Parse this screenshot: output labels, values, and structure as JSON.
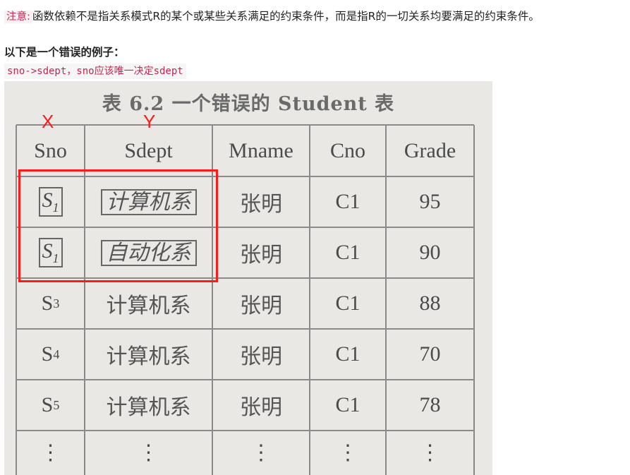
{
  "note": {
    "tag": "注意:",
    "text": "函数依赖不是指关系模式R的某个或某些关系满足的约束条件，而是指R的一切关系均要满足的约束条件。"
  },
  "heading": "以下是一个错误的例子：",
  "code": "sno->sdept，sno应该唯一决定sdept",
  "table": {
    "caption": "表 6.2   一个错误的 Student 表",
    "markers": {
      "x": "X",
      "y": "Y"
    },
    "headers": [
      "Sno",
      "Sdept",
      "Mname",
      "Cno",
      "Grade"
    ],
    "rows": [
      {
        "sno": "S",
        "sno_sub": "1",
        "sdept": "计算机系",
        "mname": "张明",
        "cno": "C1",
        "grade": "95"
      },
      {
        "sno": "S",
        "sno_sub": "1",
        "sdept": "自动化系",
        "mname": "张明",
        "cno": "C1",
        "grade": "90"
      },
      {
        "sno": "S",
        "sno_sub": "3",
        "sdept": "计算机系",
        "mname": "张明",
        "cno": "C1",
        "grade": "88"
      },
      {
        "sno": "S",
        "sno_sub": "4",
        "sdept": "计算机系",
        "mname": "张明",
        "cno": "C1",
        "grade": "70"
      },
      {
        "sno": "S",
        "sno_sub": "5",
        "sdept": "计算机系",
        "mname": "张明",
        "cno": "C1",
        "grade": "78"
      },
      {
        "sno": "⋮",
        "sno_sub": "",
        "sdept": "⋮",
        "mname": "⋮",
        "cno": "⋮",
        "grade": "⋮"
      }
    ]
  }
}
